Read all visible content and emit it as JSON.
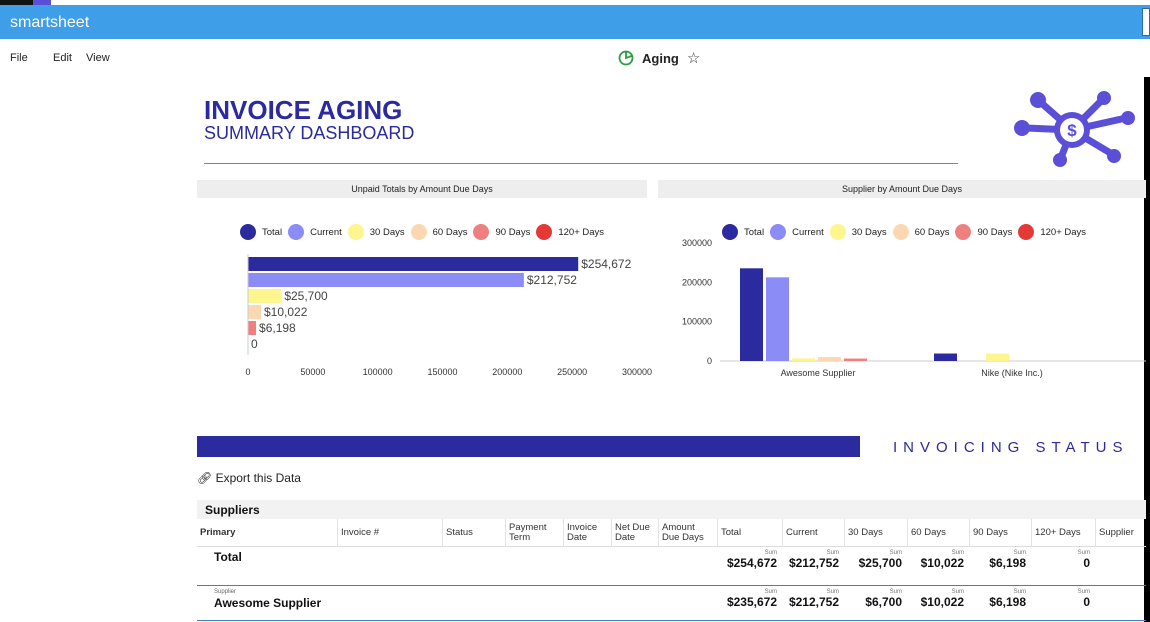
{
  "app": {
    "brand": "smartsheet",
    "top_title": ""
  },
  "menu": {
    "file": "File",
    "edit": "Edit",
    "view": "View"
  },
  "sheet": {
    "name": "Aging"
  },
  "colors": {
    "total": "#2b2a9e",
    "current": "#8b8cf6",
    "d30": "#fdf58e",
    "d60": "#fbd8b1",
    "d90": "#f08080",
    "d120": "#e53935",
    "accent": "#2b2a9e"
  },
  "dashboard": {
    "title": "INVOICE AGING",
    "subtitle": "SUMMARY DASHBOARD"
  },
  "chart_data": [
    {
      "type": "bar",
      "title": "Unpaid Totals by Amount Due Days",
      "orientation": "horizontal",
      "legend": [
        "Total",
        "Current",
        "30 Days",
        "60 Days",
        "90 Days",
        "120+ Days"
      ],
      "legend_placement": "top",
      "categories": [
        "Total",
        "Current",
        "30 Days",
        "60 Days",
        "90 Days",
        "120+ Days"
      ],
      "values": [
        254672,
        212752,
        25700,
        10022,
        6198,
        0
      ],
      "value_labels": [
        "$254,672",
        "$212,752",
        "$25,700",
        "$10,022",
        "$6,198",
        "0"
      ],
      "xlim": [
        0,
        300000
      ],
      "xticks": [
        "0",
        "50000",
        "100000",
        "150000",
        "200000",
        "250000",
        "300000"
      ]
    },
    {
      "type": "bar",
      "title": "Supplier by Amount Due Days",
      "legend": [
        "Total",
        "Current",
        "30 Days",
        "60 Days",
        "90 Days",
        "120+ Days"
      ],
      "legend_placement": "top",
      "categories": [
        "Awesome Supplier",
        "Nike (Nike Inc.)"
      ],
      "series": [
        {
          "name": "Total",
          "values": [
            235672,
            19000
          ]
        },
        {
          "name": "Current",
          "values": [
            212752,
            0
          ]
        },
        {
          "name": "30 Days",
          "values": [
            6700,
            19000
          ]
        },
        {
          "name": "60 Days",
          "values": [
            10022,
            0
          ]
        },
        {
          "name": "90 Days",
          "values": [
            6198,
            0
          ]
        },
        {
          "name": "120+ Days",
          "values": [
            0,
            0
          ]
        }
      ],
      "ylim": [
        0,
        300000
      ],
      "yticks": [
        "0",
        "100000",
        "200000",
        "300000"
      ]
    }
  ],
  "status": {
    "label": "INVOICING STATUS",
    "export": "Export this Data"
  },
  "table": {
    "title": "Suppliers",
    "columns": [
      "Primary",
      "Invoice #",
      "Status",
      "Payment Term",
      "Invoice Date",
      "Net Due Date",
      "Amount Due Days",
      "Total",
      "Current",
      "30 Days",
      "60 Days",
      "90 Days",
      "120+ Days",
      "Supplier"
    ],
    "sum_label": "Sum",
    "rows": [
      {
        "label": "Total",
        "sub": "",
        "values": [
          "$254,672",
          "$212,752",
          "$25,700",
          "$10,022",
          "$6,198",
          "0"
        ]
      },
      {
        "label": "Awesome Supplier",
        "sub": "Supplier",
        "values": [
          "$235,672",
          "$212,752",
          "$6,700",
          "$10,022",
          "$6,198",
          "0"
        ]
      }
    ]
  }
}
